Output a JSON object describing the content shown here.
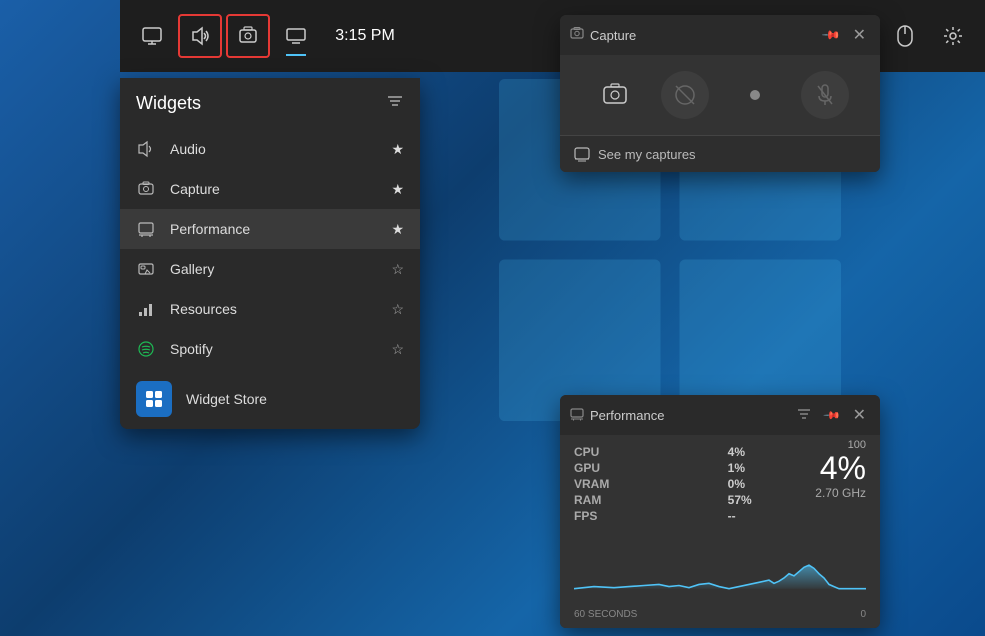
{
  "taskbar": {
    "icons": [
      {
        "name": "monitor-icon",
        "symbol": "🖥",
        "highlighted": false
      },
      {
        "name": "audio-icon",
        "symbol": "🔊",
        "highlighted": true
      },
      {
        "name": "capture-icon",
        "symbol": "⊡",
        "highlighted": true
      },
      {
        "name": "display-icon",
        "symbol": "▬",
        "highlighted": false
      }
    ],
    "time": "3:15 PM",
    "mouse_icon": "🖱",
    "settings_icon": "⚙"
  },
  "widgets_panel": {
    "title": "Widgets",
    "items": [
      {
        "id": "audio",
        "label": "Audio",
        "starred": true
      },
      {
        "id": "capture",
        "label": "Capture",
        "starred": true
      },
      {
        "id": "performance",
        "label": "Performance",
        "starred": true
      },
      {
        "id": "gallery",
        "label": "Gallery",
        "starred": false
      },
      {
        "id": "resources",
        "label": "Resources",
        "starred": false
      },
      {
        "id": "spotify",
        "label": "Spotify",
        "starred": false
      }
    ],
    "store_item": {
      "label": "Widget Store"
    }
  },
  "capture_widget": {
    "title": "Capture",
    "footer_link": "See my captures",
    "buttons": [
      {
        "name": "screenshot-btn",
        "symbol": "📷",
        "disabled": false
      },
      {
        "name": "record-btn",
        "symbol": "⊘",
        "disabled": true
      },
      {
        "name": "dot-btn",
        "symbol": "●",
        "disabled": false
      },
      {
        "name": "mic-btn",
        "symbol": "🎤",
        "disabled": true,
        "crossed": true
      }
    ]
  },
  "performance_widget": {
    "title": "Performance",
    "stats": [
      {
        "label": "CPU",
        "value": "4%"
      },
      {
        "label": "GPU",
        "value": "1%"
      },
      {
        "label": "VRAM",
        "value": "0%"
      },
      {
        "label": "RAM",
        "value": "57%"
      },
      {
        "label": "FPS",
        "value": "--"
      }
    ],
    "big_value": "4%",
    "frequency": "2.70 GHz",
    "max_value": "100",
    "min_value": "0",
    "chart_label": "60 SECONDS"
  }
}
